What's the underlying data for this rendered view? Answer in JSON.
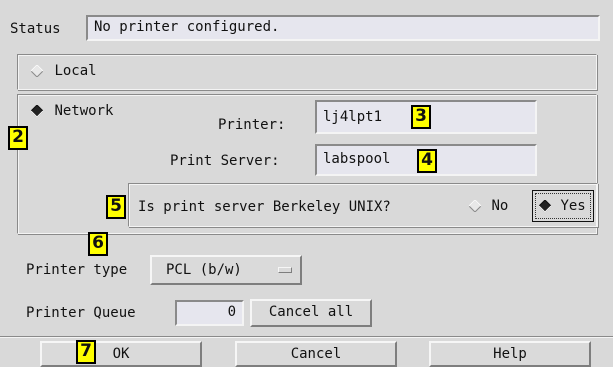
{
  "status": {
    "label": "Status",
    "value": "No printer configured."
  },
  "local": {
    "label": "Local"
  },
  "network": {
    "label": "Network",
    "printer_label": "Printer:",
    "printer_value": "lj4lpt1",
    "server_label": "Print Server:",
    "server_value": "labspool",
    "berkeley_question": "Is print server Berkeley UNIX?",
    "no_label": "No",
    "yes_label": "Yes"
  },
  "printer_type": {
    "label": "Printer type",
    "value": "PCL (b/w)"
  },
  "printer_queue": {
    "label": "Printer Queue",
    "count": "0",
    "cancel_all": "Cancel all"
  },
  "buttons": {
    "ok": "OK",
    "cancel": "Cancel",
    "help": "Help"
  },
  "badges": {
    "b2": "2",
    "b3": "3",
    "b4": "4",
    "b5": "5",
    "b6": "6",
    "b7": "7"
  },
  "colors": {
    "background": "#d9d9d9",
    "field": "#e6e6ee",
    "badge": "#ffff00"
  }
}
